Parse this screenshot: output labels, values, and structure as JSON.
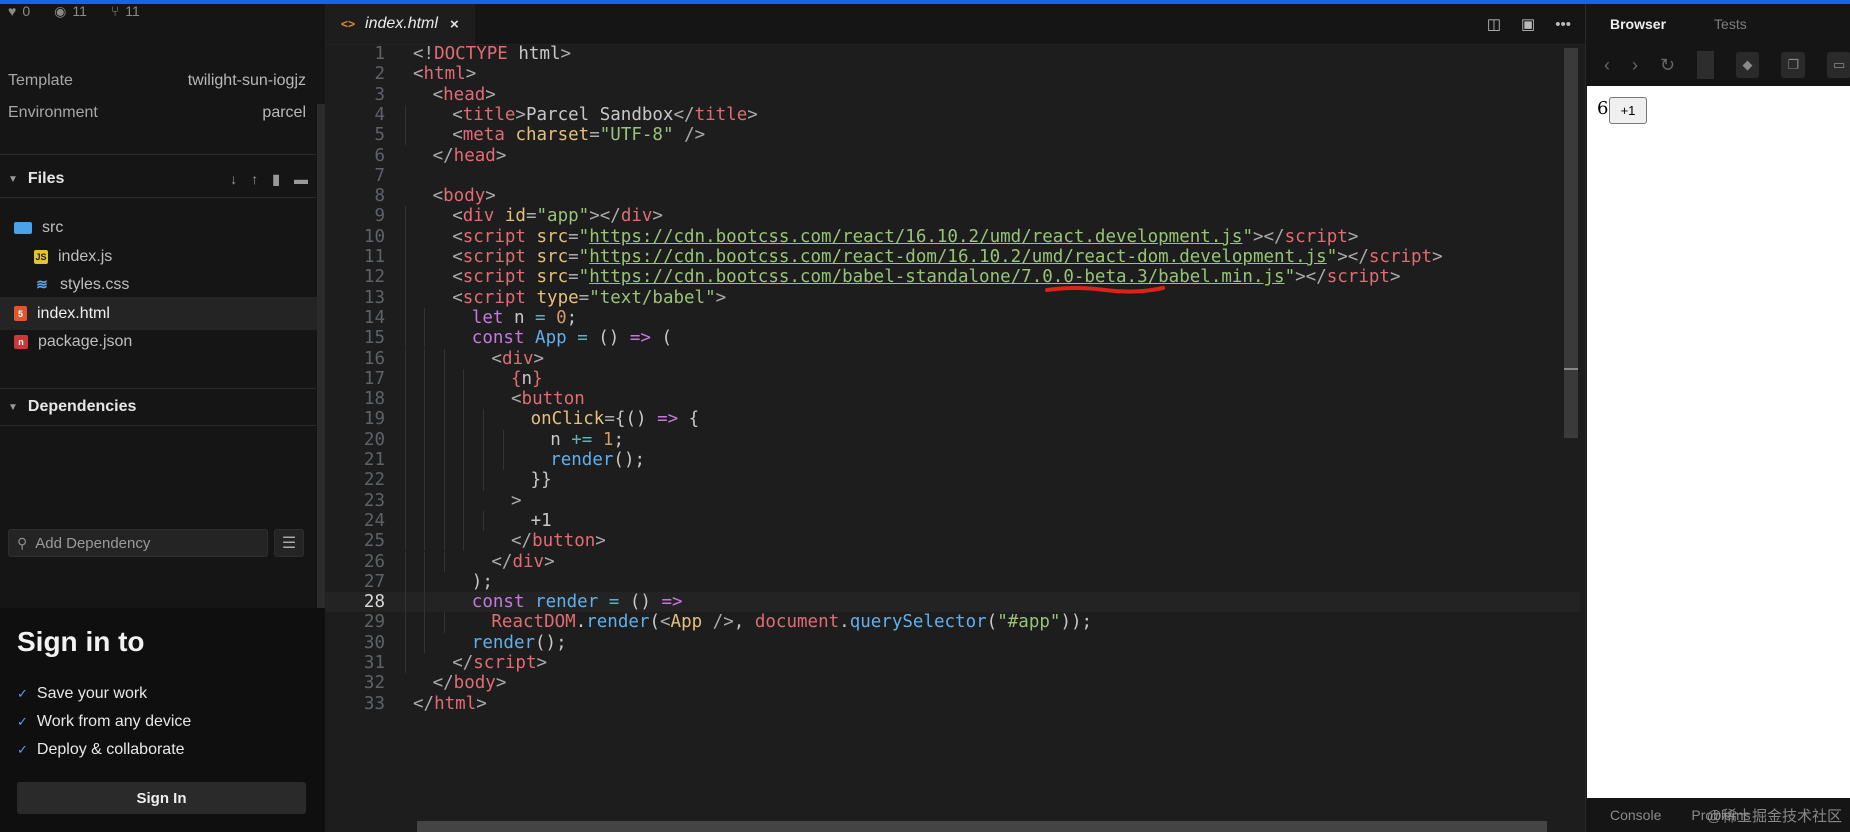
{
  "sidebar": {
    "stats": [
      {
        "icon": "heart-icon",
        "value": "0"
      },
      {
        "icon": "eye-icon",
        "value": "11"
      },
      {
        "icon": "fork-icon",
        "value": "11"
      }
    ],
    "info": [
      {
        "key": "Template",
        "value": "twilight-sun-iogjz"
      },
      {
        "key": "Environment",
        "value": "parcel"
      }
    ],
    "files_section": {
      "title": "Files",
      "tools": [
        "download-icon",
        "upload-icon",
        "new-file-icon",
        "new-folder-icon"
      ],
      "items": [
        {
          "name": "src",
          "type": "folder",
          "icon": "folder-icon"
        },
        {
          "name": "index.js",
          "type": "js",
          "icon": "js-file-icon"
        },
        {
          "name": "styles.css",
          "type": "css",
          "icon": "css-file-icon"
        },
        {
          "name": "index.html",
          "type": "html",
          "icon": "html-file-icon",
          "active": true
        },
        {
          "name": "package.json",
          "type": "json",
          "icon": "json-file-icon"
        }
      ]
    },
    "dependencies_section": {
      "title": "Dependencies",
      "add_placeholder": "Add Dependency"
    },
    "signin": {
      "title": "Sign in to",
      "bullets": [
        "Save your work",
        "Work from any device",
        "Deploy & collaborate"
      ],
      "button": "Sign In"
    }
  },
  "editor": {
    "tab": {
      "label": "index.html",
      "icon": "code-icon",
      "close": "×"
    },
    "tools": [
      "split-view-icon",
      "preview-icon",
      "more-icon"
    ],
    "current_line": 28,
    "lines": [
      {
        "n": "1",
        "indent": 0,
        "tokens": [
          [
            "punc",
            "<!"
          ],
          [
            "tag",
            "DOCTYPE"
          ],
          [
            "txt",
            " html"
          ],
          [
            "punc",
            ">"
          ]
        ]
      },
      {
        "n": "2",
        "indent": 0,
        "tokens": [
          [
            "punc",
            "<"
          ],
          [
            "tag",
            "html"
          ],
          [
            "punc",
            ">"
          ]
        ]
      },
      {
        "n": "3",
        "indent": 1,
        "tokens": [
          [
            "punc",
            "<"
          ],
          [
            "tag",
            "head"
          ],
          [
            "punc",
            ">"
          ]
        ]
      },
      {
        "n": "4",
        "indent": 2,
        "tokens": [
          [
            "punc",
            "<"
          ],
          [
            "tag",
            "title"
          ],
          [
            "punc",
            ">"
          ],
          [
            "txt",
            "Parcel Sandbox"
          ],
          [
            "punc",
            "</"
          ],
          [
            "tag",
            "title"
          ],
          [
            "punc",
            ">"
          ]
        ]
      },
      {
        "n": "5",
        "indent": 2,
        "tokens": [
          [
            "punc",
            "<"
          ],
          [
            "tag",
            "meta"
          ],
          [
            "txt",
            " "
          ],
          [
            "attr",
            "charset"
          ],
          [
            "punc",
            "="
          ],
          [
            "str",
            "\"UTF-8\""
          ],
          [
            "txt",
            " "
          ],
          [
            "punc",
            "/>"
          ]
        ]
      },
      {
        "n": "6",
        "indent": 1,
        "tokens": [
          [
            "punc",
            "</"
          ],
          [
            "tag",
            "head"
          ],
          [
            "punc",
            ">"
          ]
        ]
      },
      {
        "n": "7",
        "indent": 0,
        "tokens": []
      },
      {
        "n": "8",
        "indent": 1,
        "tokens": [
          [
            "punc",
            "<"
          ],
          [
            "tag",
            "body"
          ],
          [
            "punc",
            ">"
          ]
        ]
      },
      {
        "n": "9",
        "indent": 2,
        "tokens": [
          [
            "punc",
            "<"
          ],
          [
            "tag",
            "div"
          ],
          [
            "txt",
            " "
          ],
          [
            "attr",
            "id"
          ],
          [
            "punc",
            "="
          ],
          [
            "str",
            "\"app\""
          ],
          [
            "punc",
            "></"
          ],
          [
            "tag",
            "div"
          ],
          [
            "punc",
            ">"
          ]
        ]
      },
      {
        "n": "10",
        "indent": 2,
        "tokens": [
          [
            "punc",
            "<"
          ],
          [
            "tag",
            "script"
          ],
          [
            "txt",
            " "
          ],
          [
            "attr",
            "src"
          ],
          [
            "punc",
            "="
          ],
          [
            "str",
            "\""
          ],
          [
            "url",
            "https://cdn.bootcss.com/react/16.10.2/umd/react.development.js"
          ],
          [
            "str",
            "\""
          ],
          [
            "punc",
            "></"
          ],
          [
            "tag",
            "script"
          ],
          [
            "punc",
            ">"
          ]
        ]
      },
      {
        "n": "11",
        "indent": 2,
        "tokens": [
          [
            "punc",
            "<"
          ],
          [
            "tag",
            "script"
          ],
          [
            "txt",
            " "
          ],
          [
            "attr",
            "src"
          ],
          [
            "punc",
            "="
          ],
          [
            "str",
            "\""
          ],
          [
            "url",
            "https://cdn.bootcss.com/react-dom/16.10.2/umd/react-dom.development.js"
          ],
          [
            "str",
            "\""
          ],
          [
            "punc",
            "></"
          ],
          [
            "tag",
            "script"
          ],
          [
            "punc",
            ">"
          ]
        ]
      },
      {
        "n": "12",
        "indent": 2,
        "tokens": [
          [
            "punc",
            "<"
          ],
          [
            "tag",
            "script"
          ],
          [
            "txt",
            " "
          ],
          [
            "attr",
            "src"
          ],
          [
            "punc",
            "="
          ],
          [
            "str",
            "\""
          ],
          [
            "url",
            "https://cdn.bootcss.com/babel-standalone/7.0.0-beta.3/babel.min.js"
          ],
          [
            "str",
            "\""
          ],
          [
            "punc",
            "></"
          ],
          [
            "tag",
            "script"
          ],
          [
            "punc",
            ">"
          ]
        ]
      },
      {
        "n": "13",
        "indent": 2,
        "tokens": [
          [
            "punc",
            "<"
          ],
          [
            "tag",
            "script"
          ],
          [
            "txt",
            " "
          ],
          [
            "attr",
            "type"
          ],
          [
            "punc",
            "="
          ],
          [
            "str",
            "\"text/babel\""
          ],
          [
            "punc",
            ">"
          ]
        ]
      },
      {
        "n": "14",
        "indent": 3,
        "tokens": [
          [
            "kw",
            "let"
          ],
          [
            "txt",
            " n "
          ],
          [
            "op",
            "="
          ],
          [
            "txt",
            " "
          ],
          [
            "num",
            "0"
          ],
          [
            "txt",
            ";"
          ]
        ]
      },
      {
        "n": "15",
        "indent": 3,
        "tokens": [
          [
            "kw",
            "const"
          ],
          [
            "txt",
            " "
          ],
          [
            "fn",
            "App"
          ],
          [
            "txt",
            " "
          ],
          [
            "op",
            "="
          ],
          [
            "txt",
            " () "
          ],
          [
            "kw",
            "=>"
          ],
          [
            "txt",
            " ("
          ]
        ]
      },
      {
        "n": "16",
        "indent": 4,
        "tokens": [
          [
            "punc",
            "<"
          ],
          [
            "tag",
            "div"
          ],
          [
            "punc",
            ">"
          ]
        ]
      },
      {
        "n": "17",
        "indent": 5,
        "tokens": [
          [
            "brace",
            "{"
          ],
          [
            "txt",
            "n"
          ],
          [
            "brace",
            "}"
          ]
        ]
      },
      {
        "n": "18",
        "indent": 5,
        "tokens": [
          [
            "punc",
            "<"
          ],
          [
            "tag",
            "button"
          ]
        ]
      },
      {
        "n": "19",
        "indent": 6,
        "tokens": [
          [
            "attr",
            "onClick"
          ],
          [
            "punc",
            "="
          ],
          [
            "txt",
            "{() "
          ],
          [
            "kw",
            "=>"
          ],
          [
            "txt",
            " {"
          ]
        ]
      },
      {
        "n": "20",
        "indent": 7,
        "tokens": [
          [
            "txt",
            "n "
          ],
          [
            "op",
            "+="
          ],
          [
            "txt",
            " "
          ],
          [
            "num",
            "1"
          ],
          [
            "txt",
            ";"
          ]
        ]
      },
      {
        "n": "21",
        "indent": 7,
        "tokens": [
          [
            "fn",
            "render"
          ],
          [
            "txt",
            "();"
          ]
        ]
      },
      {
        "n": "22",
        "indent": 6,
        "tokens": [
          [
            "txt",
            "}}"
          ]
        ]
      },
      {
        "n": "23",
        "indent": 5,
        "tokens": [
          [
            "punc",
            ">"
          ]
        ]
      },
      {
        "n": "24",
        "indent": 6,
        "tokens": [
          [
            "txt",
            "+1"
          ]
        ]
      },
      {
        "n": "25",
        "indent": 5,
        "tokens": [
          [
            "punc",
            "</"
          ],
          [
            "tag",
            "button"
          ],
          [
            "punc",
            ">"
          ]
        ]
      },
      {
        "n": "26",
        "indent": 4,
        "tokens": [
          [
            "punc",
            "</"
          ],
          [
            "tag",
            "div"
          ],
          [
            "punc",
            ">"
          ]
        ]
      },
      {
        "n": "27",
        "indent": 3,
        "tokens": [
          [
            "txt",
            ");"
          ]
        ]
      },
      {
        "n": "28",
        "indent": 3,
        "tokens": [
          [
            "kw",
            "const"
          ],
          [
            "txt",
            " "
          ],
          [
            "fn",
            "render"
          ],
          [
            "txt",
            " "
          ],
          [
            "op",
            "="
          ],
          [
            "txt",
            " () "
          ],
          [
            "kw",
            "=>"
          ]
        ]
      },
      {
        "n": "29",
        "indent": 4,
        "tokens": [
          [
            "tag",
            "ReactDOM"
          ],
          [
            "txt",
            "."
          ],
          [
            "fn",
            "render"
          ],
          [
            "txt",
            "("
          ],
          [
            "punc",
            "<"
          ],
          [
            "attr",
            "App"
          ],
          [
            "txt",
            " "
          ],
          [
            "punc",
            "/>"
          ],
          [
            "txt",
            ", "
          ],
          [
            "tag",
            "document"
          ],
          [
            "txt",
            "."
          ],
          [
            "fn",
            "querySelector"
          ],
          [
            "txt",
            "("
          ],
          [
            "str",
            "\"#app\""
          ],
          [
            "txt",
            "));"
          ]
        ]
      },
      {
        "n": "30",
        "indent": 3,
        "tokens": [
          [
            "fn",
            "render"
          ],
          [
            "txt",
            "();"
          ]
        ]
      },
      {
        "n": "31",
        "indent": 2,
        "tokens": [
          [
            "punc",
            "</"
          ],
          [
            "tag",
            "script"
          ],
          [
            "punc",
            ">"
          ]
        ]
      },
      {
        "n": "32",
        "indent": 1,
        "tokens": [
          [
            "punc",
            "</"
          ],
          [
            "tag",
            "body"
          ],
          [
            "punc",
            ">"
          ]
        ]
      },
      {
        "n": "33",
        "indent": 0,
        "tokens": [
          [
            "punc",
            "</"
          ],
          [
            "tag",
            "html"
          ],
          [
            "punc",
            ">"
          ]
        ]
      }
    ]
  },
  "browser": {
    "tabs": [
      "Browser",
      "Tests"
    ],
    "nav": [
      "back-icon",
      "forward-icon",
      "refresh-icon"
    ],
    "view_tools": [
      "codesandbox-icon",
      "copy-icon",
      "window-icon"
    ],
    "preview": {
      "count": "6",
      "button": "+1"
    },
    "footer_tabs": [
      "Console",
      "Problems"
    ],
    "watermark": "@稀土掘金技术社区"
  },
  "colors": {
    "accent": "#1366e9",
    "tag": "#e06c75",
    "attr": "#e5c07b",
    "string": "#98c379",
    "keyword": "#c678dd",
    "function": "#61afef",
    "number": "#d19a66"
  }
}
